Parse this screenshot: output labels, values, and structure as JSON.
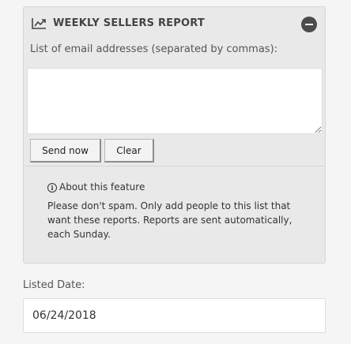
{
  "report": {
    "title": "WEEKLY SELLERS REPORT",
    "header_icon": "line-chart-icon",
    "collapse_icon": "minus-circle-icon",
    "email_label": "List of email addresses (separated by commas):",
    "email_value": "",
    "send_label": "Send now",
    "clear_label": "Clear",
    "about_title": "About this feature",
    "about_icon": "info-circle-icon",
    "about_text": "Please don't spam. Only add people to this list that want these reports. Reports are sent automatically, each Sunday."
  },
  "listed_date": {
    "label": "Listed Date:",
    "value": "06/24/2018"
  }
}
